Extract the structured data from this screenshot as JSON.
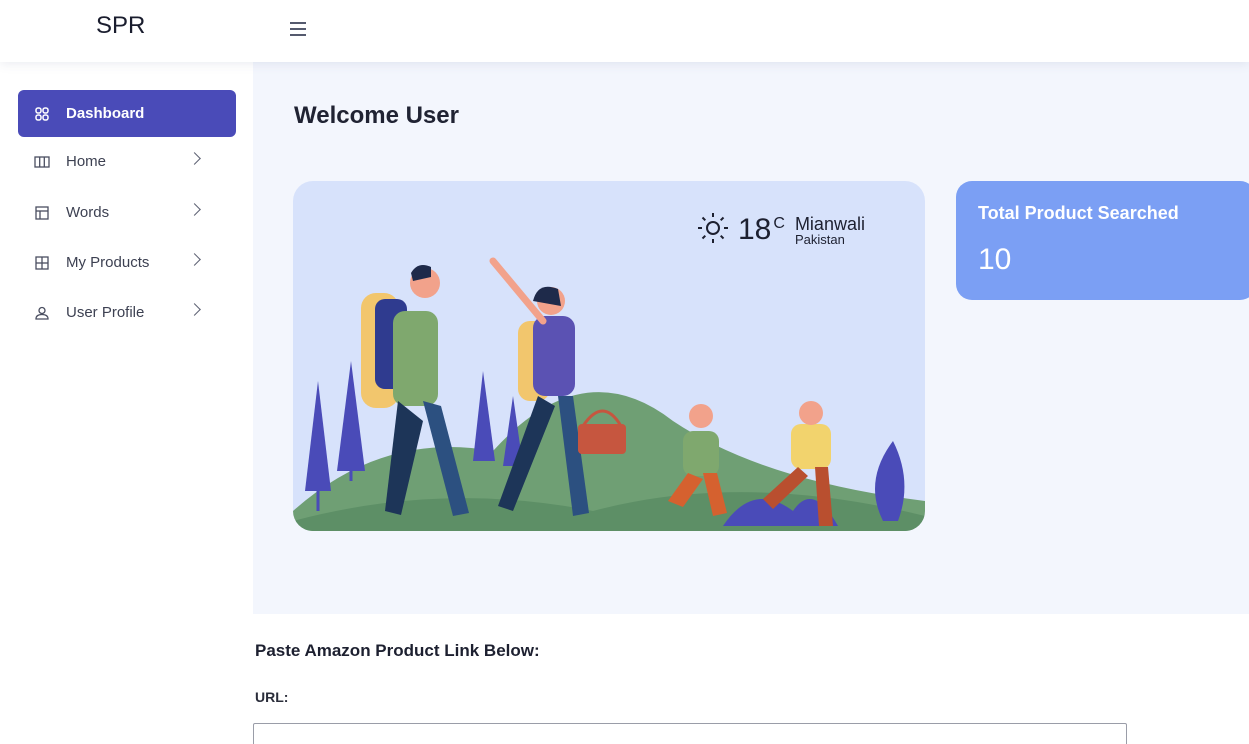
{
  "app": {
    "brand": "SPR"
  },
  "sidebar": {
    "items": [
      {
        "label": "Dashboard",
        "icon": "dashboard-grid-icon",
        "active": true
      },
      {
        "label": "Home",
        "icon": "columns-icon"
      },
      {
        "label": "Words",
        "icon": "layout-icon"
      },
      {
        "label": "My Products",
        "icon": "table-grid-icon"
      },
      {
        "label": "User Profile",
        "icon": "user-icon"
      }
    ]
  },
  "main": {
    "welcome": "Welcome User",
    "weather": {
      "icon": "sun-icon",
      "temperature": "18",
      "unit": "C",
      "city": "Mianwali",
      "country": "Pakistan"
    },
    "stat": {
      "title": "Total Product Searched",
      "value": "10"
    }
  },
  "form": {
    "title": "Paste Amazon Product Link Below:",
    "url_label": "URL:",
    "url_value": "",
    "url_placeholder": ""
  },
  "colors": {
    "accent": "#4a4bb8",
    "stat_card": "#7b9ff4",
    "hero_bg": "#d7e2fb",
    "main_bg": "#f3f6fd"
  }
}
